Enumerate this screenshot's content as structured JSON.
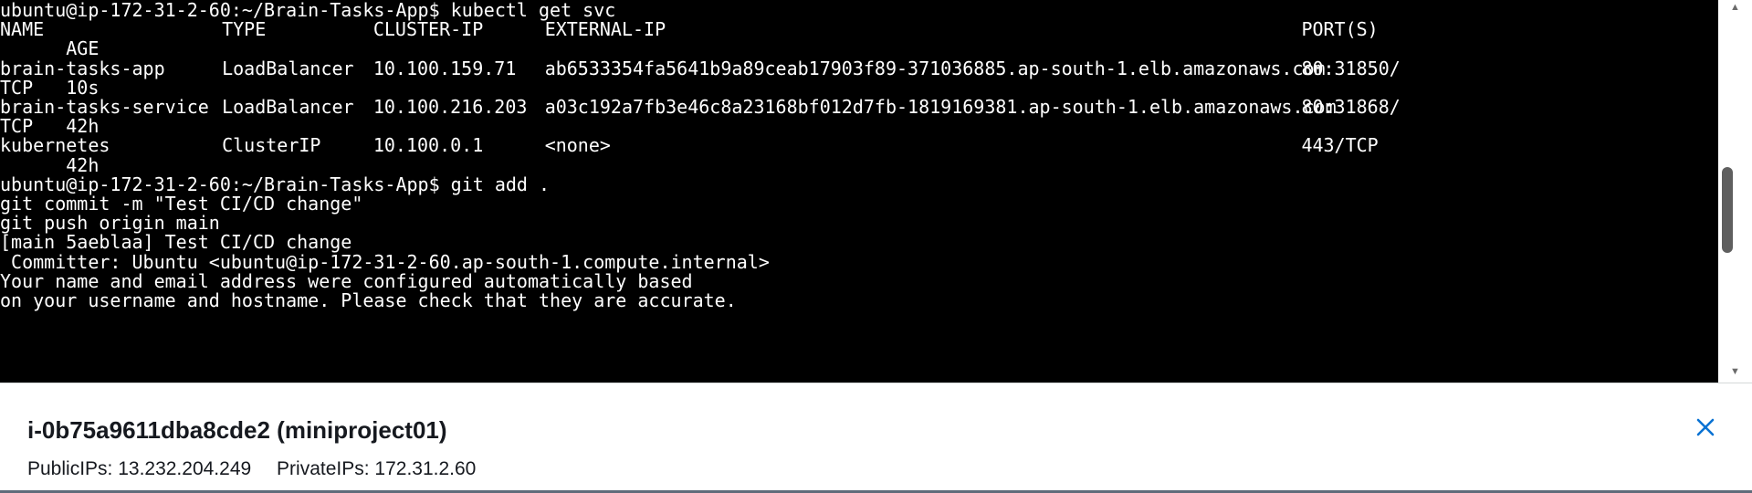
{
  "terminal": {
    "lines": [
      {
        "segs": [
          {
            "t": "ubuntu@ip-172-31-2-60:~/Brain-Tasks-App$ kubectl get svc",
            "c": 0
          }
        ]
      },
      {
        "segs": [
          {
            "t": "NAME",
            "c": 0
          },
          {
            "t": "TYPE",
            "c": 22
          },
          {
            "t": "CLUSTER-IP",
            "c": 37
          },
          {
            "t": "EXTERNAL-IP",
            "c": 54
          },
          {
            "t": "PORT(S)",
            "c": 129
          }
        ]
      },
      {
        "segs": [
          {
            "t": "      AGE",
            "c": 0
          }
        ]
      },
      {
        "segs": [
          {
            "t": "brain-tasks-app",
            "c": 0
          },
          {
            "t": "LoadBalancer",
            "c": 22
          },
          {
            "t": "10.100.159.71",
            "c": 37
          },
          {
            "t": "ab6533354fa5641b9a89ceab17903f89-371036885.ap-south-1.elb.amazonaws.com",
            "c": 54
          },
          {
            "t": "80:31850/",
            "c": 129
          }
        ]
      },
      {
        "segs": [
          {
            "t": "TCP   10s",
            "c": 0
          }
        ]
      },
      {
        "segs": [
          {
            "t": "brain-tasks-service",
            "c": 0
          },
          {
            "t": "LoadBalancer",
            "c": 22
          },
          {
            "t": "10.100.216.203",
            "c": 37
          },
          {
            "t": "a03c192a7fb3e46c8a23168bf012d7fb-1819169381.ap-south-1.elb.amazonaws.com",
            "c": 54
          },
          {
            "t": "80:31868/",
            "c": 129
          }
        ]
      },
      {
        "segs": [
          {
            "t": "TCP   42h",
            "c": 0
          }
        ]
      },
      {
        "segs": [
          {
            "t": "kubernetes",
            "c": 0
          },
          {
            "t": "ClusterIP",
            "c": 22
          },
          {
            "t": "10.100.0.1",
            "c": 37
          },
          {
            "t": "<none>",
            "c": 54
          },
          {
            "t": "443/TCP",
            "c": 129
          }
        ]
      },
      {
        "segs": [
          {
            "t": "      42h",
            "c": 0
          }
        ]
      },
      {
        "segs": [
          {
            "t": "ubuntu@ip-172-31-2-60:~/Brain-Tasks-App$ git add .",
            "c": 0
          }
        ]
      },
      {
        "segs": [
          {
            "t": "git commit -m \"Test CI/CD change\"",
            "c": 0
          }
        ]
      },
      {
        "segs": [
          {
            "t": "git push origin main",
            "c": 0
          }
        ]
      },
      {
        "segs": [
          {
            "t": "[main 5aeblaa] Test CI/CD change",
            "c": 0
          }
        ]
      },
      {
        "segs": [
          {
            "t": " Committer: Ubuntu <ubuntu@ip-172-31-2-60.ap-south-1.compute.internal>",
            "c": 0
          }
        ]
      },
      {
        "segs": [
          {
            "t": "Your name and email address were configured automatically based",
            "c": 0
          }
        ]
      },
      {
        "segs": [
          {
            "t": "on your username and hostname. Please check that they are accurate.",
            "c": 0
          }
        ]
      }
    ]
  },
  "instance": {
    "title": "i-0b75a9611dba8cde2 (miniproject01)",
    "public_ips": "PublicIPs: 13.232.204.249",
    "private_ips": "PrivateIPs: 172.31.2.60"
  },
  "icons": {
    "close": "close-icon",
    "scroll_up": "scroll-up-arrow-icon",
    "scroll_down": "scroll-down-arrow-icon"
  },
  "colors": {
    "terminal_bg": "#000000",
    "terminal_fg": "#ffffff",
    "close_icon": "#0972d3"
  }
}
